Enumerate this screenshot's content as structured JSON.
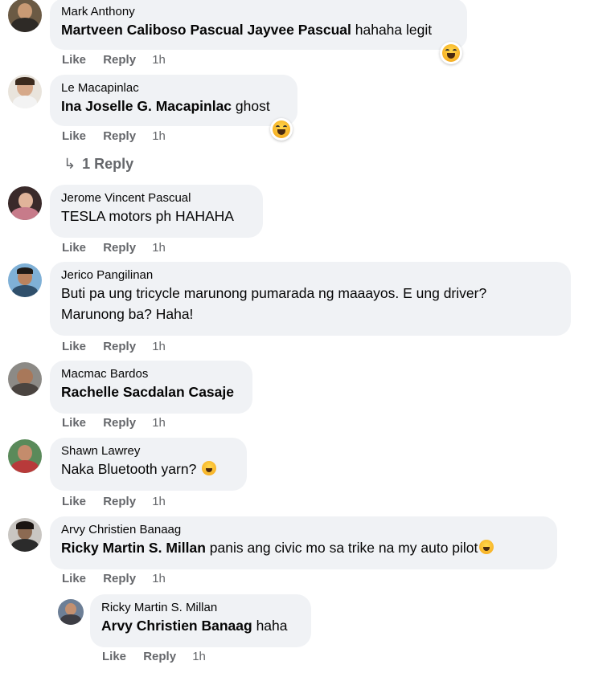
{
  "actions": {
    "like": "Like",
    "reply": "Reply"
  },
  "comments": [
    {
      "author": "Mark Anthony",
      "mention": "Martveen Caliboso Pascual Jayvee Pascual",
      "text": " hahaha legit",
      "time": "1h",
      "reaction": "laughing-emoji"
    },
    {
      "author": "Le Macapinlac",
      "mention": "Ina Joselle G. Macapinlac",
      "text": " ghost",
      "time": "1h",
      "reaction": "laughing-emoji",
      "replies_link": "1 Reply"
    },
    {
      "author": "Jerome Vincent Pascual",
      "mention": "",
      "text": "TESLA motors ph HAHAHA",
      "time": "1h"
    },
    {
      "author": "Jerico Pangilinan",
      "mention": "",
      "text": "Buti pa ung tricycle marunong pumarada ng maaayos. E ung driver?",
      "text2": "Marunong ba? Haha!",
      "time": "1h"
    },
    {
      "author": "Macmac Bardos",
      "mention": "Rachelle Sacdalan Casaje",
      "text": "",
      "time": "1h"
    },
    {
      "author": "Shawn Lawrey",
      "mention": "",
      "text": "Naka Bluetooth yarn? ",
      "time": "1h",
      "inline_emoji": "laughing-emoji"
    },
    {
      "author": "Arvy Christien Banaag",
      "mention": "Ricky Martin S. Millan",
      "text": " panis ang civic mo sa trike na my auto pilot",
      "time": "1h",
      "inline_emoji": "rofl-emoji"
    },
    {
      "author": "Ricky Martin S. Millan",
      "mention": "Arvy Christien Banaag",
      "text": " haha",
      "time": "1h",
      "nested": true
    }
  ]
}
